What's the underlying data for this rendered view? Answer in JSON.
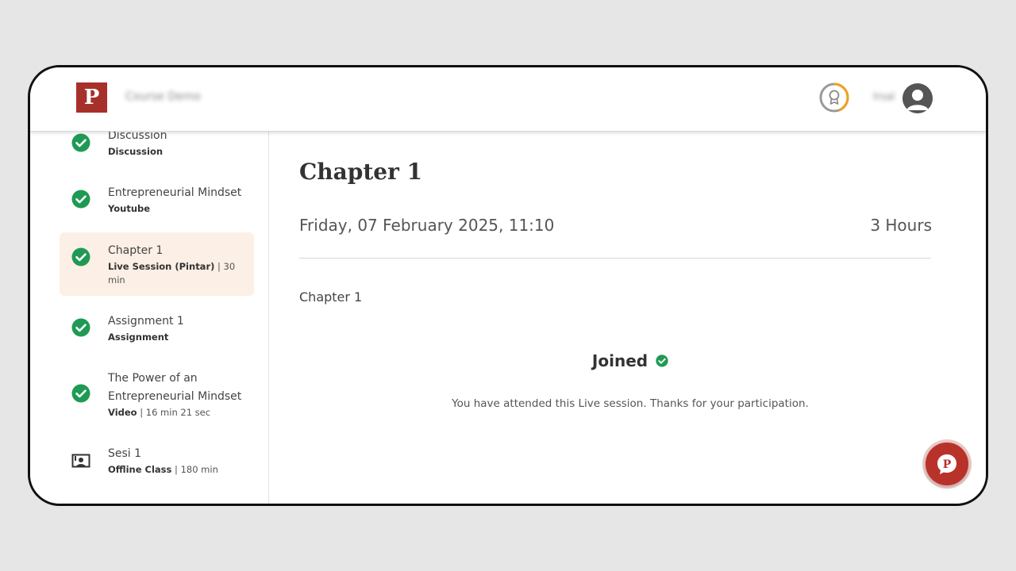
{
  "brand": {
    "logo_letter": "P",
    "accent": "#a8302a"
  },
  "header": {
    "course_title": "Course Demo",
    "user_name": "Irsal"
  },
  "sidebar": {
    "items": [
      {
        "title": "Discussion",
        "type": "Discussion",
        "detail": "",
        "status": "completed",
        "icon": "check-circle-icon"
      },
      {
        "title": "Entrepreneurial Mindset",
        "type": "Youtube",
        "detail": "",
        "status": "completed",
        "icon": "check-circle-icon"
      },
      {
        "title": "Chapter 1",
        "type": "Live Session (Pintar)",
        "detail": "| 30 min",
        "status": "completed",
        "icon": "check-circle-icon",
        "active": true
      },
      {
        "title": "Assignment 1",
        "type": "Assignment",
        "detail": "",
        "status": "completed",
        "icon": "check-circle-icon"
      },
      {
        "title": "The Power of an Entrepreneurial Mindset",
        "type": "Video",
        "detail": "| 16 min 21 sec",
        "status": "completed",
        "icon": "check-circle-icon"
      },
      {
        "title": "Sesi 1",
        "type": "Offline Class",
        "detail": "| 180 min",
        "status": "not-started",
        "icon": "classroom-icon"
      }
    ]
  },
  "main": {
    "title": "Chapter 1",
    "date": "Friday, 07 February 2025, 11:10",
    "duration": "3 Hours",
    "description": "Chapter 1",
    "status_label": "Joined",
    "status_message": "You have attended this Live session. Thanks for your participation."
  },
  "colors": {
    "success": "#1e9a54",
    "active_bg": "#fcefe5",
    "cert_ring": "#f0a020"
  }
}
